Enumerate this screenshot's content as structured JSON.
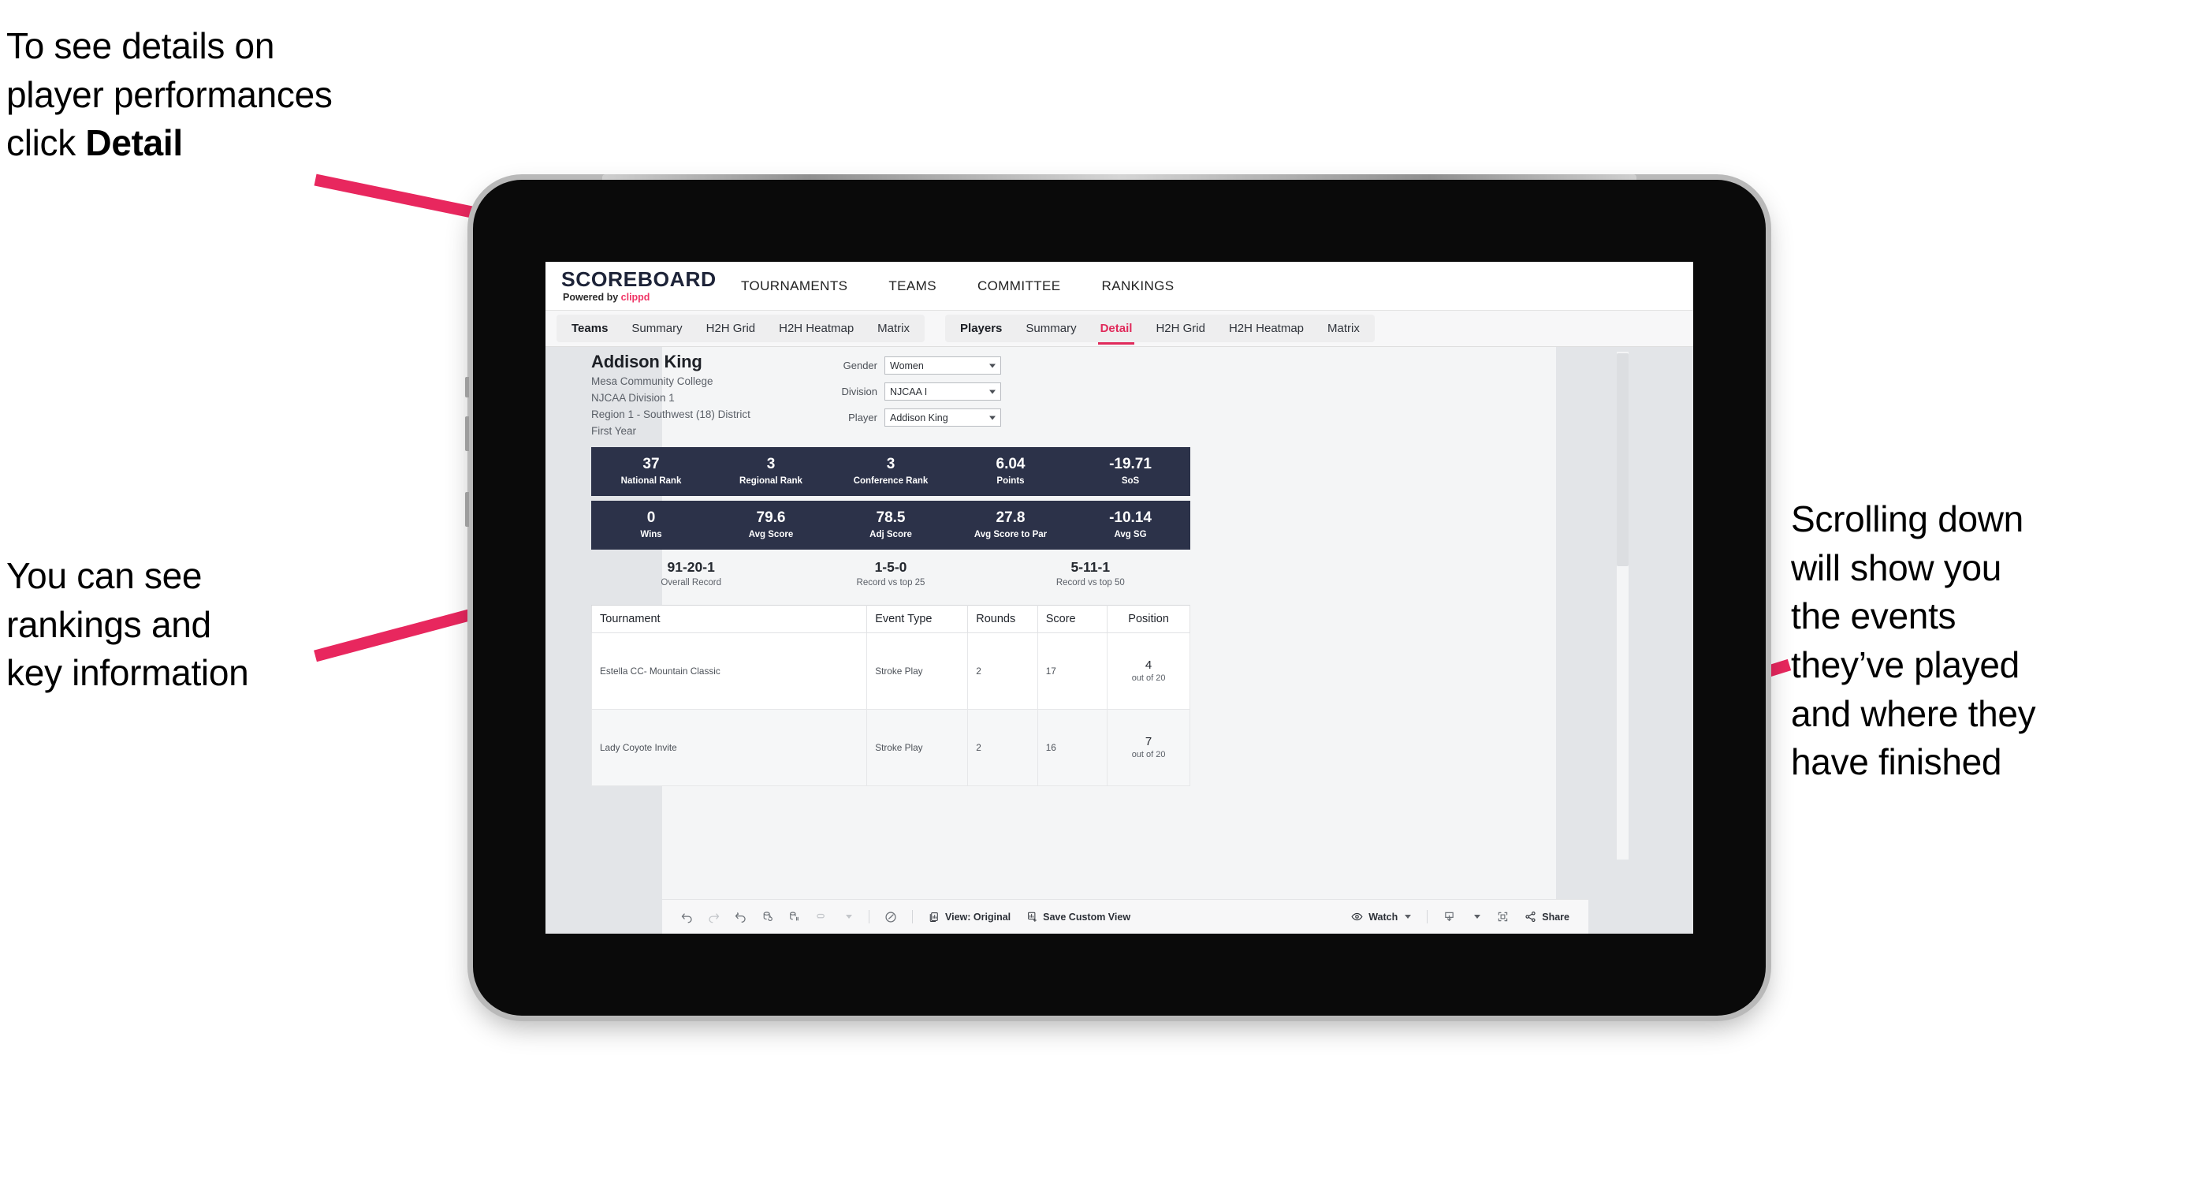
{
  "annotations": {
    "top_left": "To see details on\nplayer performances\nclick ",
    "top_left_bold": "Detail",
    "left": "You can see\nrankings and\nkey information",
    "right": "Scrolling down\nwill show you\nthe events\nthey’ve played\nand where they\nhave finished",
    "arrow_color": "#e8275e"
  },
  "app": {
    "logo": {
      "word": "SCOREBOARD",
      "powered_prefix": "Powered by ",
      "brand": "clippd"
    },
    "top_nav": [
      "TOURNAMENTS",
      "TEAMS",
      "COMMITTEE",
      "RANKINGS"
    ],
    "tab_groups": [
      {
        "label": "Teams",
        "tabs": [
          "Summary",
          "H2H Grid",
          "H2H Heatmap",
          "Matrix"
        ],
        "active": null
      },
      {
        "label": "Players",
        "tabs": [
          "Summary",
          "Detail",
          "H2H Grid",
          "H2H Heatmap",
          "Matrix"
        ],
        "active": "Detail"
      }
    ]
  },
  "player": {
    "name": "Addison King",
    "college": "Mesa Community College",
    "division": "NJCAA Division 1",
    "region": "Region 1 - Southwest (18) District",
    "year": "First Year"
  },
  "filters": [
    {
      "label": "Gender",
      "value": "Women"
    },
    {
      "label": "Division",
      "value": "NJCAA I"
    },
    {
      "label": "Player",
      "value": "Addison King"
    }
  ],
  "stats_row_1": [
    {
      "value": "37",
      "label": "National Rank"
    },
    {
      "value": "3",
      "label": "Regional Rank"
    },
    {
      "value": "3",
      "label": "Conference Rank"
    },
    {
      "value": "6.04",
      "label": "Points"
    },
    {
      "value": "-19.71",
      "label": "SoS"
    }
  ],
  "stats_row_2": [
    {
      "value": "0",
      "label": "Wins"
    },
    {
      "value": "79.6",
      "label": "Avg Score"
    },
    {
      "value": "78.5",
      "label": "Adj Score"
    },
    {
      "value": "27.8",
      "label": "Avg Score to Par"
    },
    {
      "value": "-10.14",
      "label": "Avg SG"
    }
  ],
  "records": [
    {
      "value": "91-20-1",
      "label": "Overall Record"
    },
    {
      "value": "1-5-0",
      "label": "Record vs top 25"
    },
    {
      "value": "5-11-1",
      "label": "Record vs top 50"
    }
  ],
  "table": {
    "headers": [
      "Tournament",
      "Event Type",
      "Rounds",
      "Score",
      "Position"
    ],
    "rows": [
      {
        "tournament": "Estella CC- Mountain Classic",
        "event_type": "Stroke Play",
        "rounds": "2",
        "score": "17",
        "position": "4",
        "position_of": "out of 20"
      },
      {
        "tournament": "Lady Coyote Invite",
        "event_type": "Stroke Play",
        "rounds": "2",
        "score": "16",
        "position": "7",
        "position_of": "out of 20"
      }
    ]
  },
  "toolbar": {
    "view_label": "View: Original",
    "save_label": "Save Custom View",
    "watch_label": "Watch",
    "share_label": "Share"
  },
  "colors": {
    "navy": "#2c3249",
    "accent_pink": "#e02a5b",
    "brand_pink": "#ef3465"
  }
}
